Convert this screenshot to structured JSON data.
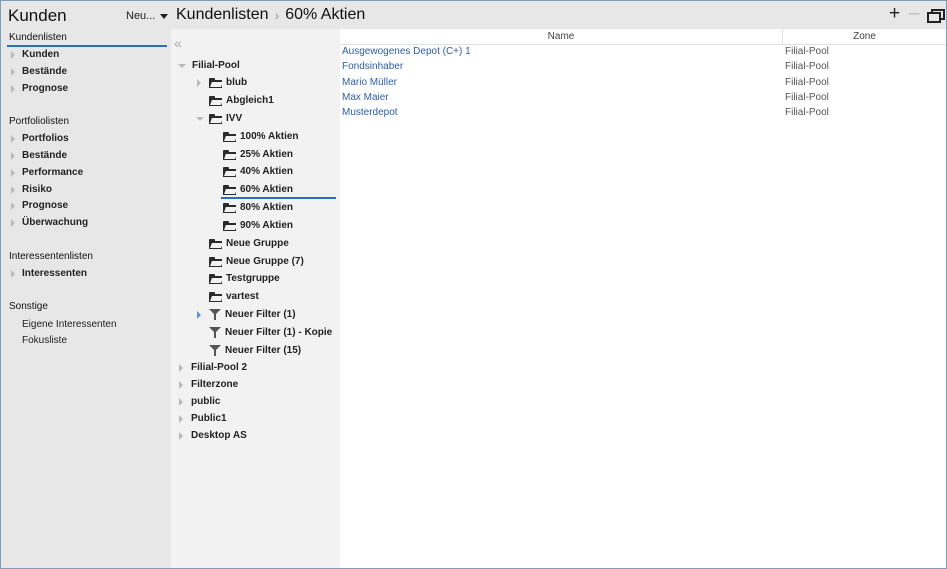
{
  "app": {
    "title": "Kunden",
    "new_label": "Neu..."
  },
  "nav": {
    "sections": [
      {
        "title": "Kundenlisten",
        "items": [
          "Kunden",
          "Bestände",
          "Prognose"
        ]
      },
      {
        "title": "Portfoliolisten",
        "items": [
          "Portfolios",
          "Bestände",
          "Performance",
          "Risiko",
          "Prognose",
          "Überwachung"
        ]
      },
      {
        "title": "Interessentenlisten",
        "items": [
          "Interessenten"
        ]
      },
      {
        "title": "Sonstige",
        "items": [
          "Eigene Interessenten",
          "Fokusliste"
        ]
      }
    ]
  },
  "breadcrumb": {
    "root": "Kundenlisten",
    "current": "60% Aktien"
  },
  "header_buttons": {
    "add": "+",
    "remove": "–"
  },
  "tree": [
    "Filial-Pool",
    "blub",
    "Abgleich1",
    "IVV",
    "100% Aktien",
    "25% Aktien",
    "40% Aktien",
    "60% Aktien",
    "80% Aktien",
    "90% Aktien",
    "Neue Gruppe",
    "Neue Gruppe (7)",
    "Testgruppe",
    "vartest",
    "Neuer Filter (1)",
    "Neuer Filter (1) - Kopie",
    "Neuer Filter (15)",
    "Filial-Pool 2",
    "Filterzone",
    "public",
    "Public1",
    "Desktop AS"
  ],
  "table": {
    "columns": [
      "Name",
      "Zone"
    ],
    "rows": [
      [
        "Ausgewogenes Depot (C+) 1",
        "Filial-Pool"
      ],
      [
        "Fondsinhaber",
        "Filial-Pool"
      ],
      [
        "Mario Müller",
        "Filial-Pool"
      ],
      [
        "Max Maier",
        "Filial-Pool"
      ],
      [
        "Musterdepot",
        "Filial-Pool"
      ]
    ]
  },
  "colors": {
    "accent": "#2f6db5",
    "link": "#2c5ea8",
    "nav_bg": "#e7e7e7",
    "tree_bg": "#f2f2f2"
  }
}
